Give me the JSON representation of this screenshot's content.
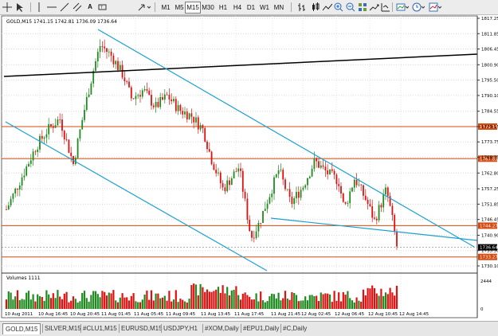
{
  "toolbar": {
    "timeframes": [
      "M1",
      "M5",
      "M15",
      "M30",
      "H1",
      "H4",
      "D1",
      "W1",
      "MN"
    ],
    "active_timeframe": "M15",
    "icons": [
      "crosshair-icon",
      "cursor-icon",
      "vertical-line-icon",
      "horizontal-line-icon",
      "trendline-icon",
      "channel-icon",
      "text-icon",
      "label-icon",
      "arrow-tool-icon",
      "bar-chart-icon",
      "candlestick-icon",
      "line-chart-icon",
      "zoom-in-icon",
      "zoom-out-icon",
      "tile-icon",
      "autoscroll-icon",
      "chart-shift-icon",
      "indicators-icon",
      "periods-icon",
      "templates-icon"
    ]
  },
  "chart": {
    "header": "GOLD,M15  1741.15 1742.81 1736.09 1736.64",
    "volumes_label": "Volumes 1111",
    "price_labels": [
      "1817.25",
      "1811.85",
      "1806.45",
      "1800.90",
      "1795.50",
      "1790.10",
      "1784.55",
      "1779.15",
      "1773.75",
      "1768.35",
      "1762.80",
      "1757.25",
      "1751.85",
      "1746.45",
      "1740.90",
      "1735.50",
      "1730.10"
    ],
    "level_labels": [
      "1779.15",
      "1767.85",
      "1744.27",
      "1736.64",
      "1733.27"
    ],
    "volume_scale": [
      "2444",
      "0"
    ],
    "time_labels": [
      "10 Aug 2011",
      "10 Aug 16:45",
      "10 Aug 20:45",
      "11 Aug 01:45",
      "11 Aug 05:45",
      "11 Aug 09:45",
      "11 Aug 13:45",
      "11 Aug 17:45",
      "11 Aug 21:45",
      "12 Aug 02:45",
      "12 Aug 06:45",
      "12 Aug 10:45",
      "12 Aug 14:45"
    ],
    "colors": {
      "bull": "#1f8a1f",
      "bear": "#e01010",
      "level": "#d44a10",
      "trend": "#1ca0d0",
      "resistance": "#000000",
      "current": "#000000"
    }
  },
  "tabs": [
    {
      "label": "GOLD,M15",
      "active": true
    },
    {
      "label": "SILVER,M15",
      "active": false
    },
    {
      "label": "#CLU1,M15",
      "active": false
    },
    {
      "label": "EURUSD,M15",
      "active": false
    },
    {
      "label": "USDJPY,H1",
      "active": false
    },
    {
      "label": "#XOM,Daily",
      "active": false
    },
    {
      "label": "#EPU1,Daily",
      "active": false
    },
    {
      "label": "#C,Daily",
      "active": false
    }
  ]
}
